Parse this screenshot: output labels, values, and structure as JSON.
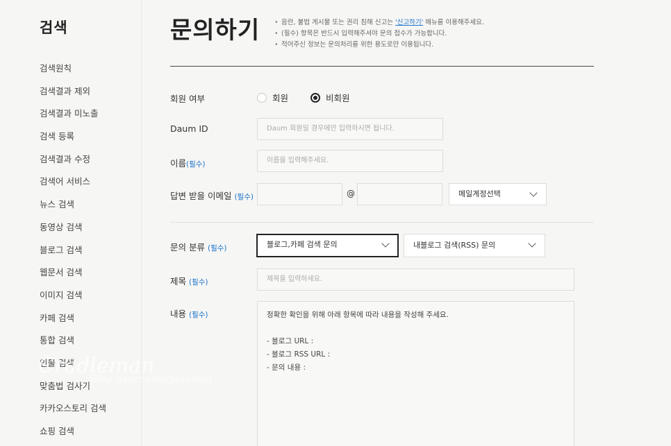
{
  "sidebar": {
    "title": "검색",
    "items": [
      {
        "label": "검색원칙"
      },
      {
        "label": "검색결과 제외"
      },
      {
        "label": "검색결과 미노출"
      },
      {
        "label": "검색 등록"
      },
      {
        "label": "검색결과 수정"
      },
      {
        "label": "검색어 서비스"
      },
      {
        "label": "뉴스 검색"
      },
      {
        "label": "동영상 검색"
      },
      {
        "label": "블로그 검색"
      },
      {
        "label": "웹문서 검색"
      },
      {
        "label": "이미지 검색"
      },
      {
        "label": "카페 검색"
      },
      {
        "label": "통합 검색"
      },
      {
        "label": "인물 검색"
      },
      {
        "label": "맞춤법 검사기"
      },
      {
        "label": "카카오스토리 검색"
      },
      {
        "label": "쇼핑 검색"
      }
    ]
  },
  "header": {
    "title": "문의하기",
    "notice1_pre": "음란, 불법 게시물 또는 권리 침해 신고는 ",
    "notice1_link": "'신고하기'",
    "notice1_post": " 메뉴를 이용해주세요.",
    "notice2": "(필수) 항목은 반드시 입력해주셔야 문의 접수가 가능합니다.",
    "notice3": "적어주신 정보는 문의처리를 위한 용도로만 이용됩니다."
  },
  "form": {
    "required_mark": "(필수)",
    "member": {
      "label": "회원 여부",
      "options": [
        "회원",
        "비회원"
      ],
      "selected": "비회원"
    },
    "daum_id": {
      "label": "Daum ID",
      "placeholder": "Daum 회원일 경우에만 입력하시면 됩니다."
    },
    "name": {
      "label": "이름",
      "placeholder": "이름을 입력해주세요."
    },
    "email": {
      "label": "답변 받을 이메일",
      "at": "@",
      "domain_select": "메일계정선택"
    },
    "category": {
      "label": "문의 분류",
      "primary": "블로그,카페 검색 문의",
      "secondary": "내블로그 검색(RSS) 문의"
    },
    "subject": {
      "label": "제목",
      "placeholder": "제목을 입력하세요."
    },
    "content": {
      "label": "내용",
      "text": "정확한 확인을 위해 아래 항목에 따라 내용을 작성해 주세요.\n\n- 블로그 URL :\n- 블로그 RSS URL :\n- 문의 내용 :"
    }
  },
  "watermark": {
    "line1": "Cradleman",
    "line2": "Blog.naver.com/planman"
  }
}
